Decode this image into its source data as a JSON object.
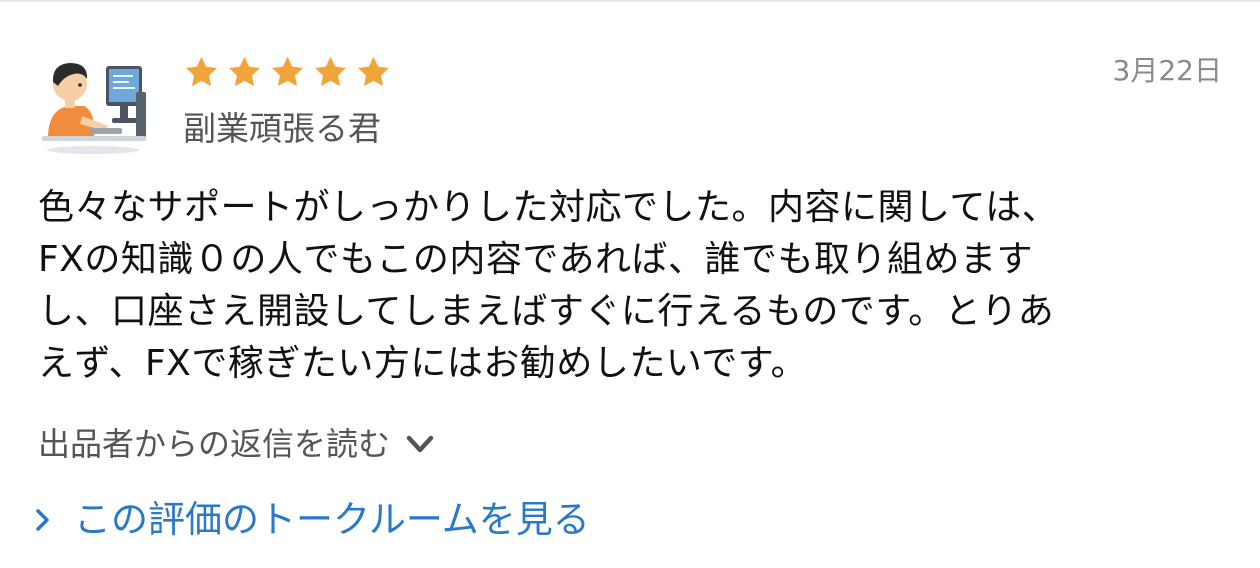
{
  "review": {
    "rating": 5,
    "rating_max": 5,
    "star_color": "#f2a33a",
    "date": "3月22日",
    "username": "副業頑張る君",
    "avatar_icon": "person-at-computer-icon",
    "body_lines": [
      "色々なサポートがしっかりした対応でした。内容に関しては、",
      "FXの知識０の人でもこの内容であれば、誰でも取り組めます",
      "し、口座さえ開設してしまえばすぐに行えるものです。とりあ",
      "えず、FXで稼ぎたい方にはお勧めしたいです。"
    ]
  },
  "reply": {
    "label": "出品者からの返信を読む",
    "icon": "chevron-down-icon"
  },
  "talk_link": {
    "label": "この評価のトークルームを見る",
    "icon": "chevron-right-icon",
    "color": "#2a79c9"
  }
}
